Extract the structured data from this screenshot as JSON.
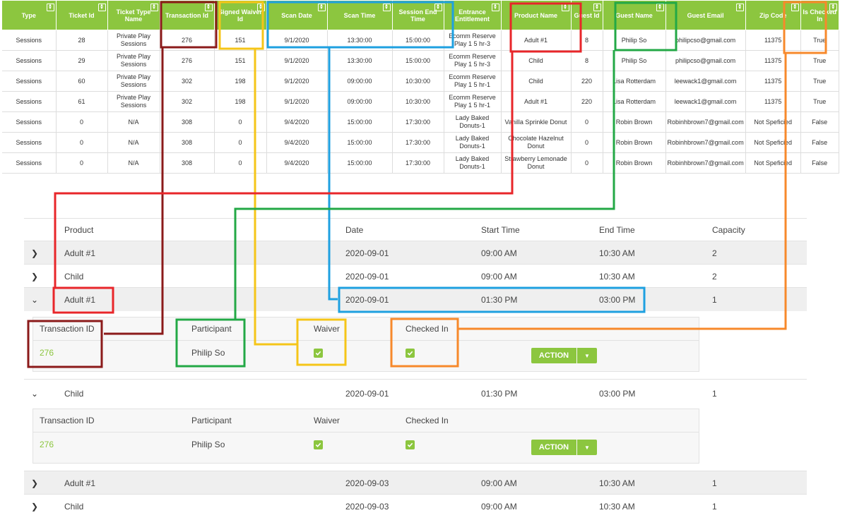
{
  "sheet": {
    "headers": [
      "Type",
      "Ticket Id",
      "Ticket Type Name",
      "Transaction Id",
      "Signed Waiver Id",
      "Scan Date",
      "Scan Time",
      "Session End Time",
      "Entrance Entitlement",
      "Product Name",
      "Guest Id",
      "Guest Name",
      "Guest Email",
      "Zip Code",
      "Is Checked In"
    ],
    "rows": [
      [
        "Sessions",
        "28",
        "Private Play Sessions",
        "276",
        "151",
        "9/1/2020",
        "13:30:00",
        "15:00:00",
        "Ecomm Reserve Play 1 5 hr-3",
        "Adult #1",
        "8",
        "Philip So",
        "philipcso@gmail.com",
        "11375",
        "True"
      ],
      [
        "Sessions",
        "29",
        "Private Play Sessions",
        "276",
        "151",
        "9/1/2020",
        "13:30:00",
        "15:00:00",
        "Ecomm Reserve Play 1 5 hr-3",
        "Child",
        "8",
        "Philip So",
        "philipcso@gmail.com",
        "11375",
        "True"
      ],
      [
        "Sessions",
        "60",
        "Private Play Sessions",
        "302",
        "198",
        "9/1/2020",
        "09:00:00",
        "10:30:00",
        "Ecomm Reserve Play 1 5 hr-1",
        "Child",
        "220",
        "Lisa Rotterdam",
        "leewack1@gmail.com",
        "11375",
        "True"
      ],
      [
        "Sessions",
        "61",
        "Private Play Sessions",
        "302",
        "198",
        "9/1/2020",
        "09:00:00",
        "10:30:00",
        "Ecomm Reserve Play 1 5 hr-1",
        "Adult #1",
        "220",
        "Lisa Rotterdam",
        "leewack1@gmail.com",
        "11375",
        "True"
      ],
      [
        "Sessions",
        "0",
        "N/A",
        "308",
        "0",
        "9/4/2020",
        "15:00:00",
        "17:30:00",
        "Lady Baked Donuts-1",
        "Vanilla Sprinkle Donut",
        "0",
        "Robin Brown",
        "Robinhbrown7@gmail.com",
        "Not Speficied",
        "False"
      ],
      [
        "Sessions",
        "0",
        "N/A",
        "308",
        "0",
        "9/4/2020",
        "15:00:00",
        "17:30:00",
        "Lady Baked Donuts-1",
        "Chocolate Hazelnut Donut",
        "0",
        "Robin Brown",
        "Robinhbrown7@gmail.com",
        "Not Speficied",
        "False"
      ],
      [
        "Sessions",
        "0",
        "N/A",
        "308",
        "0",
        "9/4/2020",
        "15:00:00",
        "17:30:00",
        "Lady Baked Donuts-1",
        "Strawberry Lemonade Donut",
        "0",
        "Robin Brown",
        "Robinhbrown7@gmail.com",
        "Not Speficied",
        "False"
      ]
    ]
  },
  "grid": {
    "headers": {
      "product": "Product",
      "date": "Date",
      "start": "Start Time",
      "end": "End Time",
      "capacity": "Capacity"
    },
    "rows": [
      {
        "product": "Adult #1",
        "date": "2020-09-01",
        "start": "09:00 AM",
        "end": "10:30 AM",
        "capacity": "2"
      },
      {
        "product": "Child",
        "date": "2020-09-01",
        "start": "09:00 AM",
        "end": "10:30 AM",
        "capacity": "2"
      },
      {
        "product": "Adult #1",
        "date": "2020-09-01",
        "start": "01:30 PM",
        "end": "03:00 PM",
        "capacity": "1"
      },
      {
        "product": "Child",
        "date": "2020-09-01",
        "start": "01:30 PM",
        "end": "03:00 PM",
        "capacity": "1"
      },
      {
        "product": "Adult #1",
        "date": "2020-09-03",
        "start": "09:00 AM",
        "end": "10:30 AM",
        "capacity": "1"
      },
      {
        "product": "Child",
        "date": "2020-09-03",
        "start": "09:00 AM",
        "end": "10:30 AM",
        "capacity": "1"
      }
    ],
    "detail_headers": {
      "txn": "Transaction ID",
      "participant": "Participant",
      "waiver": "Waiver",
      "checked": "Checked In"
    },
    "details": [
      {
        "txn": "276",
        "participant": "Philip So",
        "waiver": true,
        "checked": true,
        "action": "ACTION"
      },
      {
        "txn": "276",
        "participant": "Philip So",
        "waiver": true,
        "checked": true,
        "action": "ACTION"
      }
    ]
  },
  "colors": {
    "accent": "#8cc63f",
    "dark_red": "#8b1a1a",
    "yellow": "#f5c518",
    "blue": "#1ea0e0",
    "red": "#e8262a",
    "green": "#23a846",
    "orange": "#f7892b"
  },
  "icons": {
    "expand": "chevron-right-icon",
    "collapse": "chevron-down-icon",
    "sort": "sort-icon",
    "check": "check-icon",
    "dropdown": "caret-down-icon"
  }
}
